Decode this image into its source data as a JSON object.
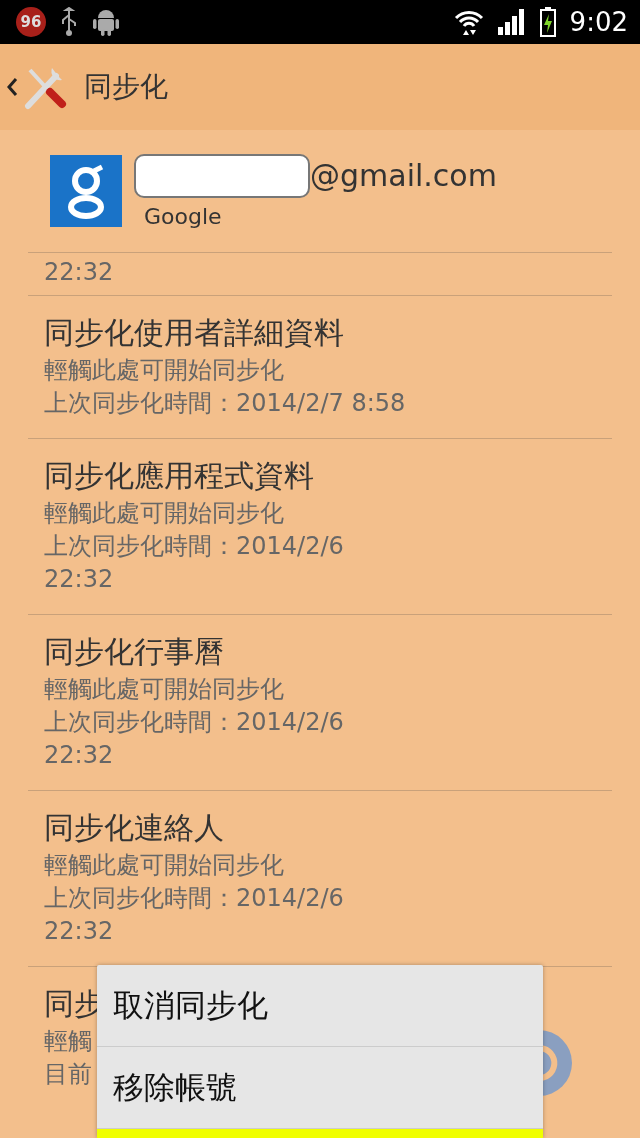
{
  "status_bar": {
    "badge": "96",
    "time": "9:02"
  },
  "action_bar": {
    "title": "同步化"
  },
  "account": {
    "email": "@gmail.com",
    "type": "Google"
  },
  "sync_items": [
    {
      "kind": "partial",
      "lines": [
        "22:32"
      ]
    },
    {
      "kind": "item",
      "title": "同步化使用者詳細資料",
      "lines": [
        "輕觸此處可開始同步化",
        "上次同步化時間：2014/2/7 8:58"
      ]
    },
    {
      "kind": "item",
      "title": "同步化應用程式資料",
      "lines": [
        "輕觸此處可開始同步化",
        "上次同步化時間：2014/2/6",
        "22:32"
      ]
    },
    {
      "kind": "item",
      "title": "同步化行事曆",
      "lines": [
        "輕觸此處可開始同步化",
        "上次同步化時間：2014/2/6",
        "22:32"
      ]
    },
    {
      "kind": "item",
      "title": "同步化連絡人",
      "lines": [
        "輕觸此處可開始同步化",
        "上次同步化時間：2014/2/6",
        "22:32"
      ]
    },
    {
      "kind": "syncing",
      "title": "同步",
      "lines": [
        "輕觸",
        "目前"
      ]
    }
  ],
  "menu": [
    {
      "label": "取消同步化",
      "selected": false
    },
    {
      "label": "移除帳號",
      "selected": false
    },
    {
      "selected": true
    }
  ]
}
